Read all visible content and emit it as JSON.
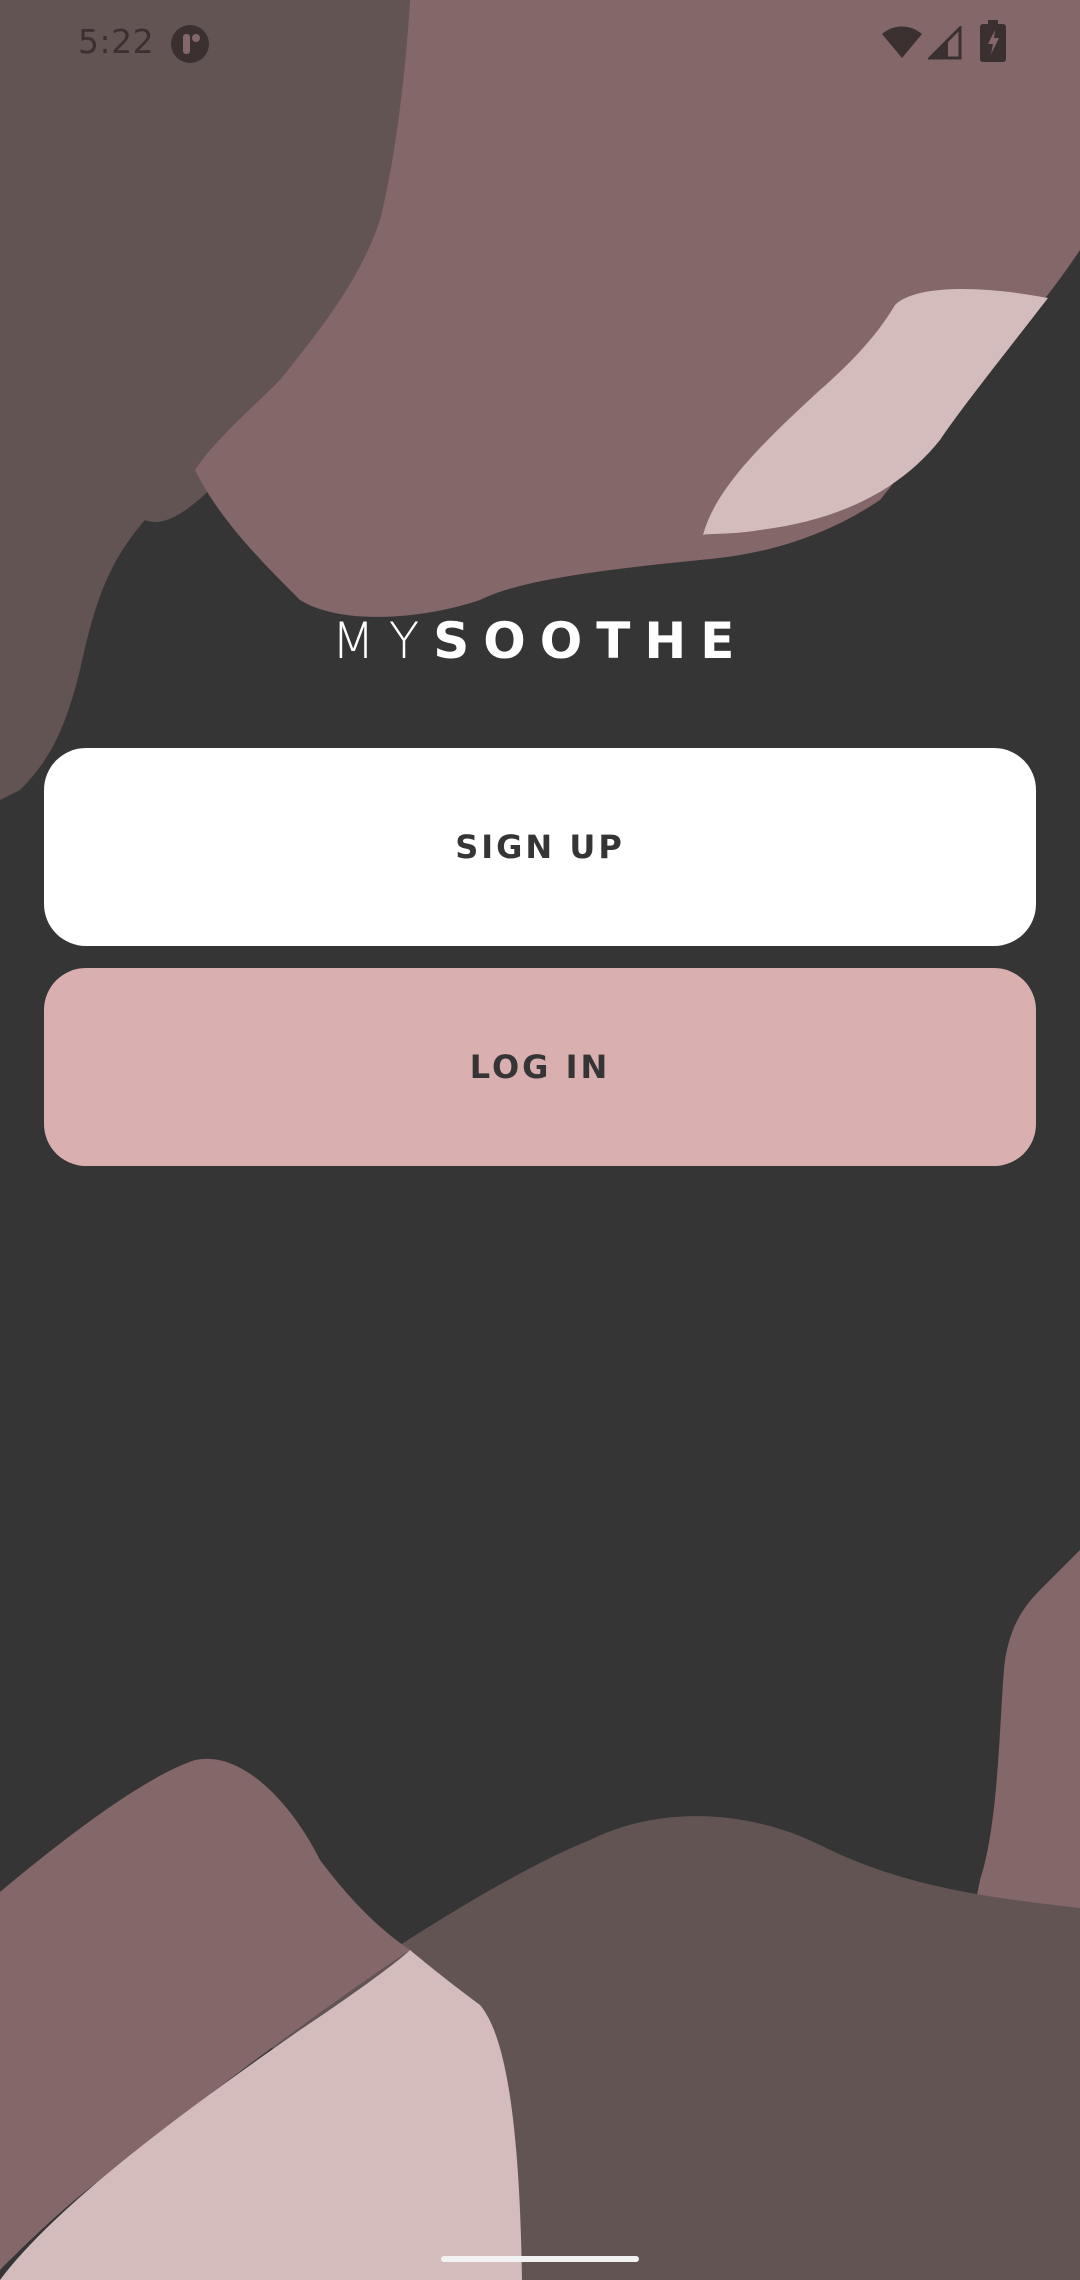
{
  "status_bar": {
    "time": "5:22",
    "icons": [
      "notification-r-icon",
      "wifi-icon",
      "cell-signal-icon",
      "battery-charging-icon"
    ]
  },
  "logo": {
    "part_light": "MY",
    "part_bold": "SOOTHE"
  },
  "buttons": {
    "signup_label": "SIGN UP",
    "login_label": "LOG IN"
  },
  "colors": {
    "background": "#353535",
    "blob_taupe": "#625453",
    "blob_mauve": "#846768",
    "blob_pink_light": "#d4bcbd",
    "signup_bg": "#ffffff",
    "login_bg": "#d9afb0",
    "button_text": "#353535"
  }
}
